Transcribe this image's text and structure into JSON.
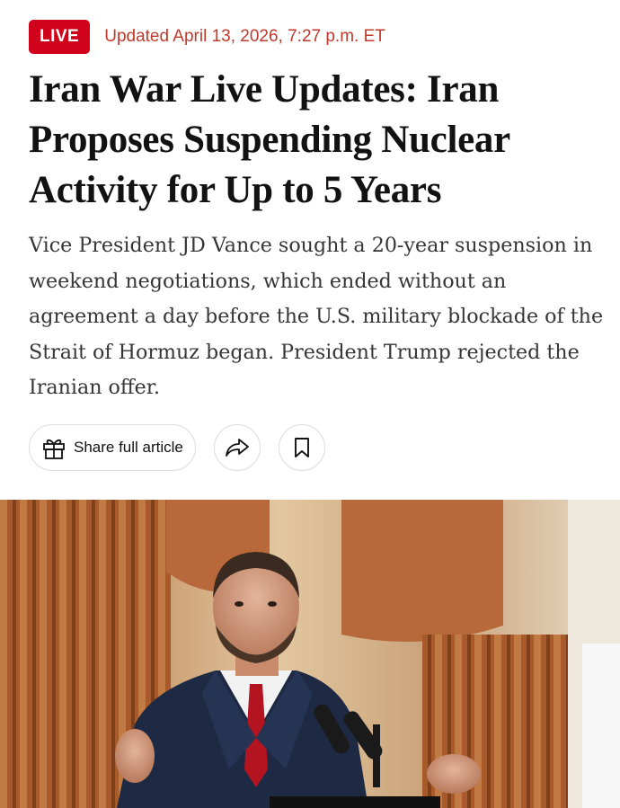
{
  "header": {
    "live_label": "LIVE",
    "updated_text": "Updated April 13, 2026, 7:27 p.m. ET"
  },
  "article": {
    "headline": "Iran War Live Updates: Iran Proposes Suspending Nuclear Activity for Up to 5 Years",
    "summary": "Vice President JD Vance sought a 20-year suspension in weekend negotiations, which ended without an agreement a day before the U.S. military blockade of the Strait of Hormuz began. President Trump rejected the Iranian offer."
  },
  "actions": {
    "share_full_article_label": "Share full article",
    "share_icon": "share-arrow-icon",
    "bookmark_icon": "bookmark-icon",
    "gift_icon": "gift-icon"
  },
  "colors": {
    "live_badge": "#d0021b",
    "updated_text": "#c0392b",
    "headline": "#121212",
    "summary": "#363636"
  }
}
